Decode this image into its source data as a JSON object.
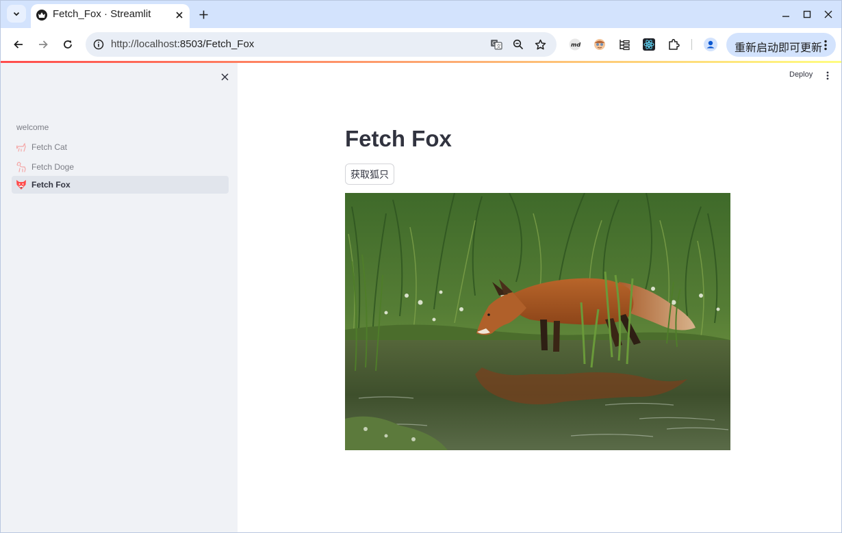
{
  "browser": {
    "tab_title": "Fetch_Fox · Streamlit",
    "url_host": "http://localhost",
    "url_rest": ":8503/Fetch_Fox",
    "update_label": "重新启动即可更新"
  },
  "header": {
    "deploy_label": "Deploy"
  },
  "sidebar": {
    "items": [
      {
        "label": "welcome",
        "icon": "none"
      },
      {
        "label": "Fetch Cat",
        "icon": "cat-icon"
      },
      {
        "label": "Fetch Doge",
        "icon": "dog-icon"
      },
      {
        "label": "Fetch Fox",
        "icon": "fox-icon",
        "active": true
      }
    ]
  },
  "main": {
    "title": "Fetch Fox",
    "button_label": "获取狐只",
    "image_subject": "red fox drinking from a pond"
  },
  "colors": {
    "streamlit_red": "#ff4b4b",
    "sidebar_bg": "#f0f2f6",
    "text": "#31333f",
    "chrome_tab_strip": "#d3e3fd"
  }
}
